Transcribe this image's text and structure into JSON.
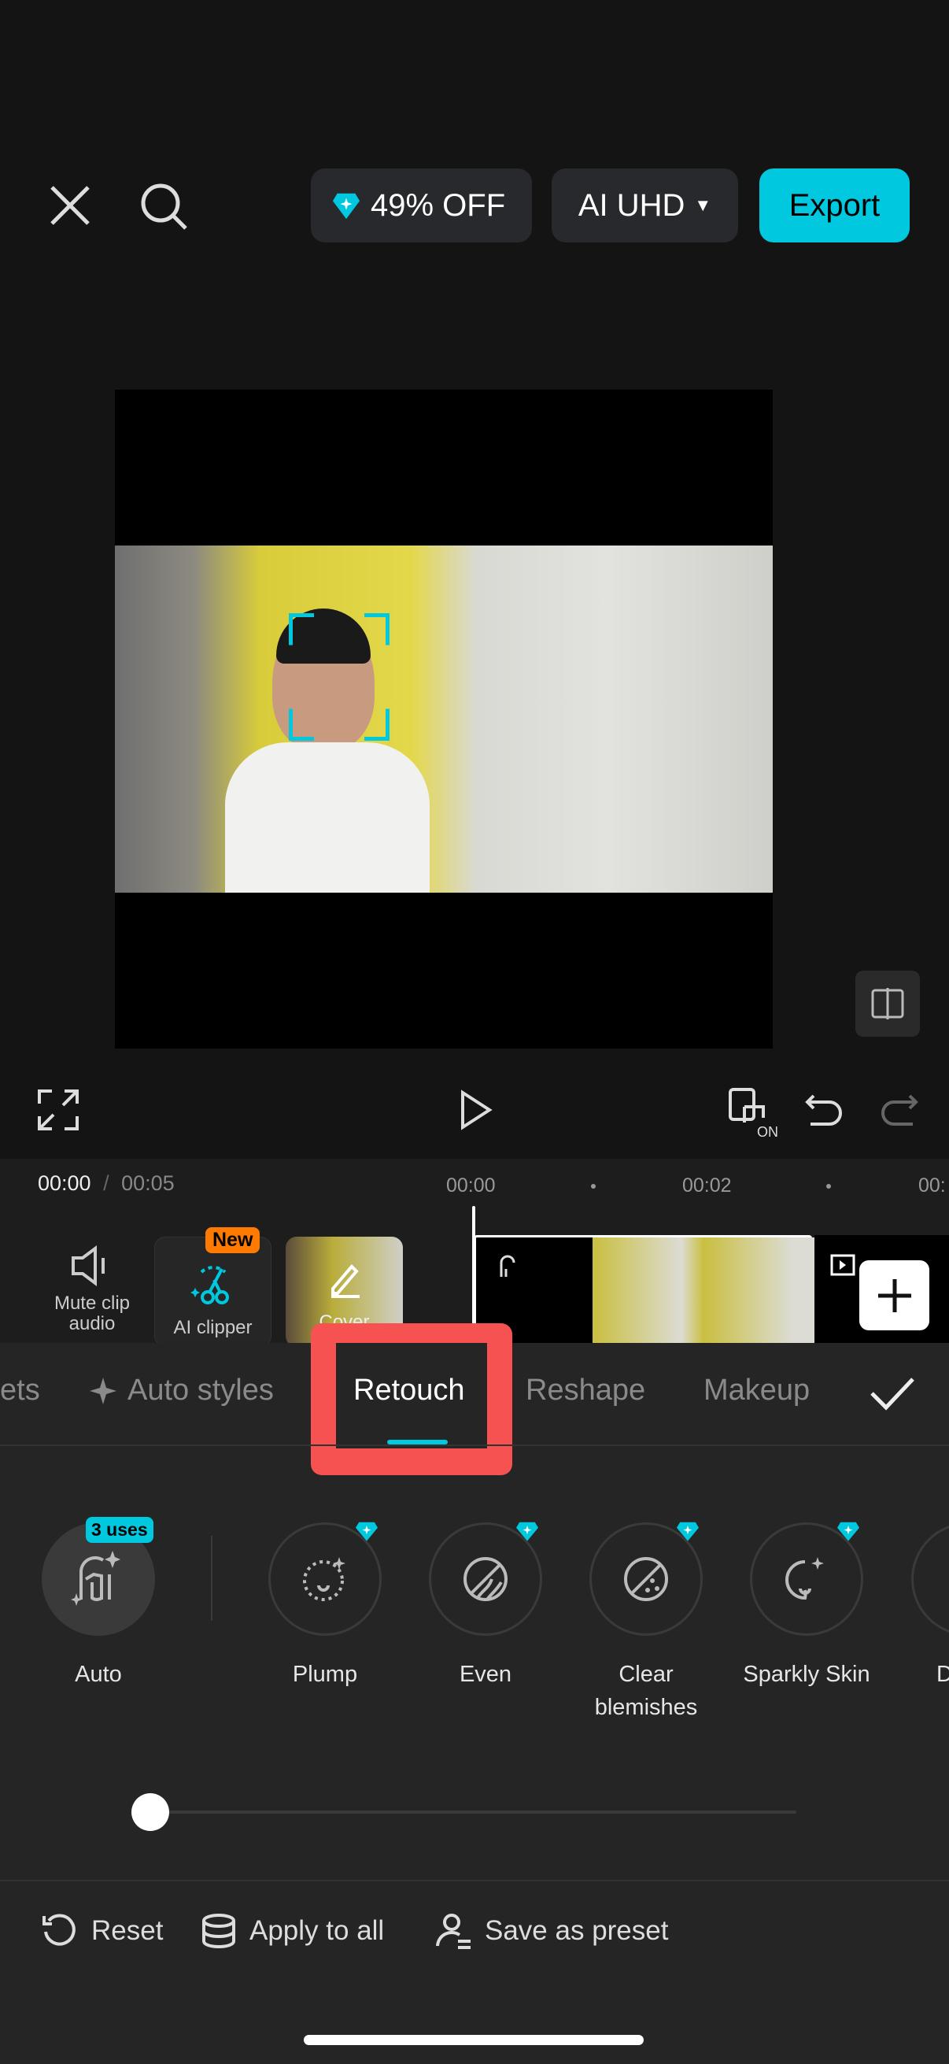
{
  "topbar": {
    "promo_label": "49% OFF",
    "quality_label": "AI UHD",
    "export_label": "Export"
  },
  "timeline": {
    "current_time": "00:00",
    "separator": "/",
    "total_time": "00:05",
    "ruler": [
      "00:00",
      "00:02",
      "00:"
    ]
  },
  "tools": [
    {
      "label": "Mute clip audio"
    },
    {
      "label": "AI clipper",
      "badge": "New"
    },
    {
      "label": "Cover"
    }
  ],
  "tabs": [
    {
      "label": "ets"
    },
    {
      "label": "Auto styles"
    },
    {
      "label": "Retouch",
      "active": true
    },
    {
      "label": "Reshape"
    },
    {
      "label": "Makeup"
    }
  ],
  "retouch_items": [
    {
      "label": "Auto",
      "badge": "3 uses"
    },
    {
      "label": "Plump",
      "premium": true
    },
    {
      "label": "Even",
      "premium": true
    },
    {
      "label": "Clear blemishes",
      "premium": true
    },
    {
      "label": "Sparkly Skin",
      "premium": true
    },
    {
      "label": "Dew"
    }
  ],
  "slider": {
    "value": 0
  },
  "actions": {
    "reset": "Reset",
    "apply_all": "Apply to all",
    "save_preset": "Save as preset"
  },
  "colors": {
    "accent": "#00c8de",
    "highlight": "#f75252",
    "new_badge": "#ff7a00"
  }
}
